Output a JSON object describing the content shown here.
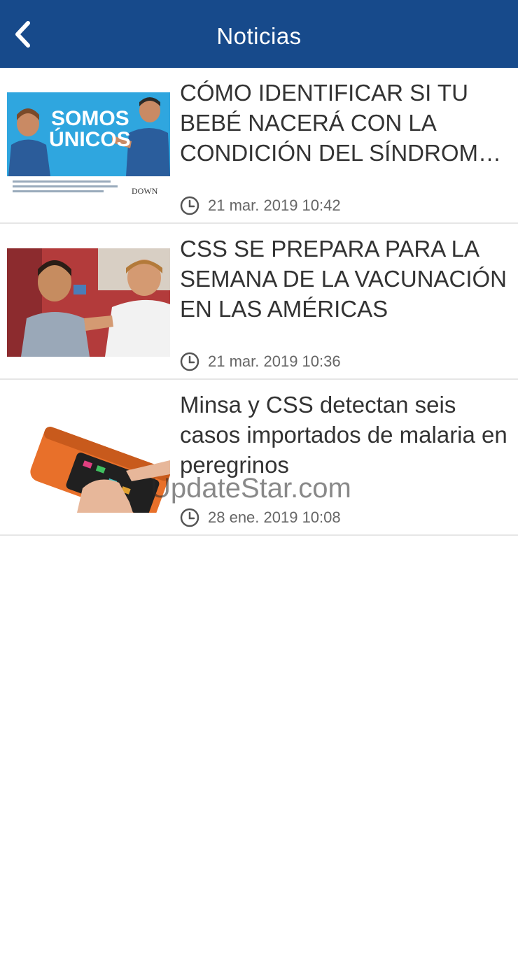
{
  "appbar": {
    "title": "Noticias",
    "back_icon": "chevron-left-icon",
    "background": "#174a8b"
  },
  "news": [
    {
      "title": "CÓMO IDENTIFICAR SI TU BEBÉ NACERÁ CON LA CONDICIÓN DEL SÍNDROME DE DOWN",
      "date": "21 mar. 2019 10:42",
      "image_text": {
        "line1": "SOMOS",
        "line2": "ÚNICOS",
        "logo": "DOWN"
      }
    },
    {
      "title": "CSS SE PREPARA PARA LA SEMANA DE LA VACUNACIÓN EN LAS AMÉRICAS",
      "date": "21 mar. 2019 10:36"
    },
    {
      "title": "Minsa y CSS detectan seis casos importados de malaria en peregrinos",
      "date": "28 ene. 2019 10:08"
    }
  ],
  "watermark": "UpdateStar.com"
}
